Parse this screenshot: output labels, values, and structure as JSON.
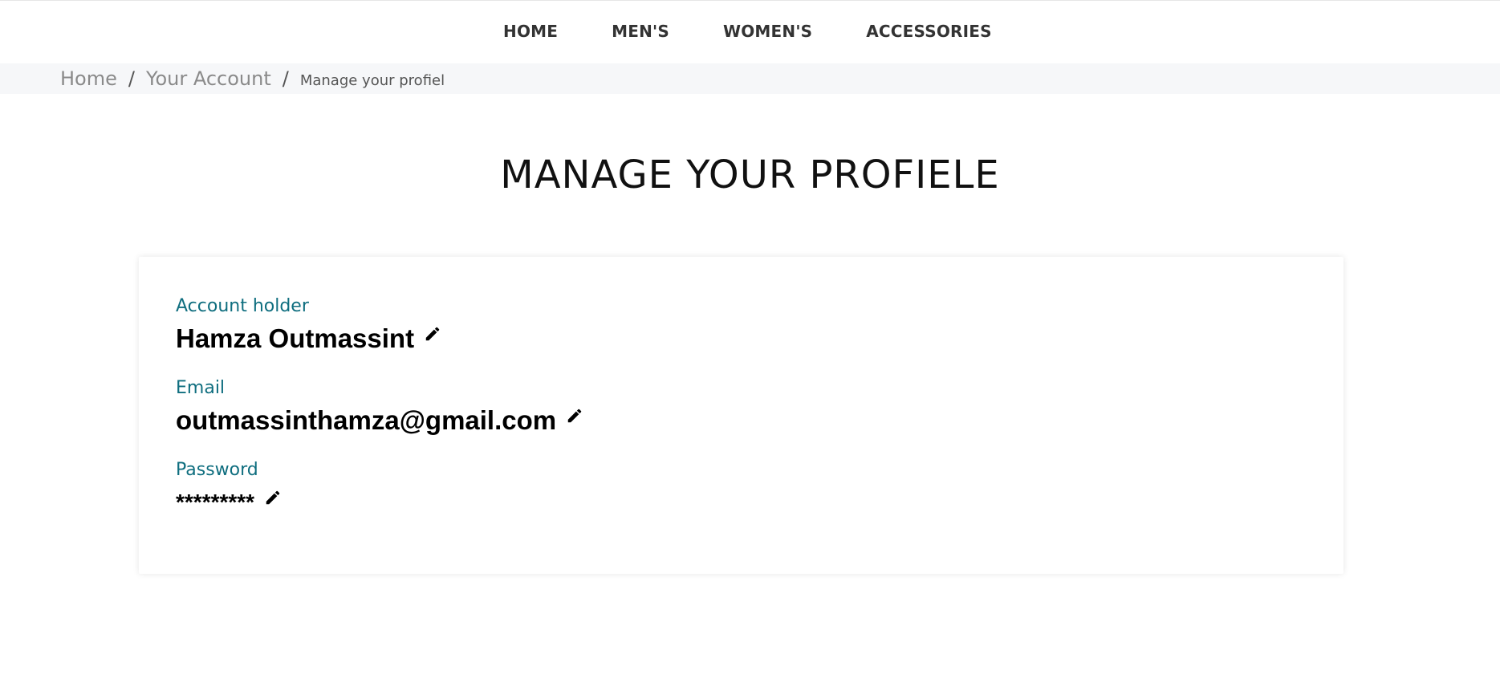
{
  "nav": {
    "items": [
      {
        "label": "HOME"
      },
      {
        "label": "MEN'S"
      },
      {
        "label": "WOMEN'S"
      },
      {
        "label": "ACCESSORIES"
      }
    ]
  },
  "breadcrumb": {
    "home": "Home",
    "separator": "/",
    "account": "Your Account",
    "current": "Manage your profiel"
  },
  "page": {
    "title": "MANAGE YOUR PROFIELE"
  },
  "profile": {
    "account_holder_label": "Account holder",
    "account_holder_value": "Hamza Outmassint",
    "email_label": "Email",
    "email_value": "outmassinthamza@gmail.com",
    "password_label": "Password",
    "password_value": "*********"
  },
  "icons": {
    "edit": "pencil-icon"
  },
  "colors": {
    "label": "#0f6e7f",
    "breadcrumb_bg": "#f6f7f9",
    "nav_text": "#333333"
  }
}
